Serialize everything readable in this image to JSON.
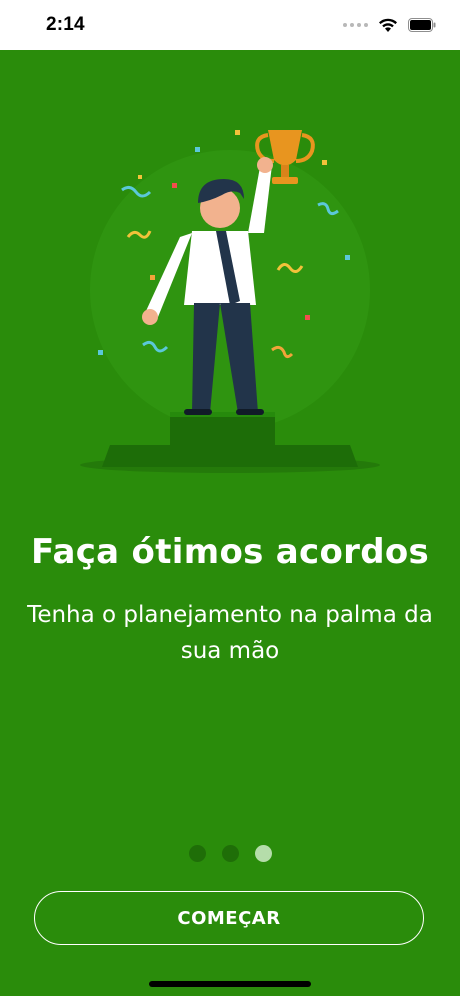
{
  "status_bar": {
    "time": "2:14"
  },
  "onboarding": {
    "title": "Faça ótimos acordos",
    "subtitle": "Tenha o planejamento na palma da sua mão",
    "page_indicator": {
      "total": 3,
      "current": 3
    },
    "start_button_label": "COMEÇAR"
  },
  "colors": {
    "background": "#2a8c0b",
    "dot_inactive": "#1f6e08",
    "dot_active": "#b5ddaa"
  },
  "icons": {
    "illustration": "man-holding-trophy-on-podium-illustration",
    "wifi": "wifi-icon",
    "battery": "battery-icon"
  }
}
